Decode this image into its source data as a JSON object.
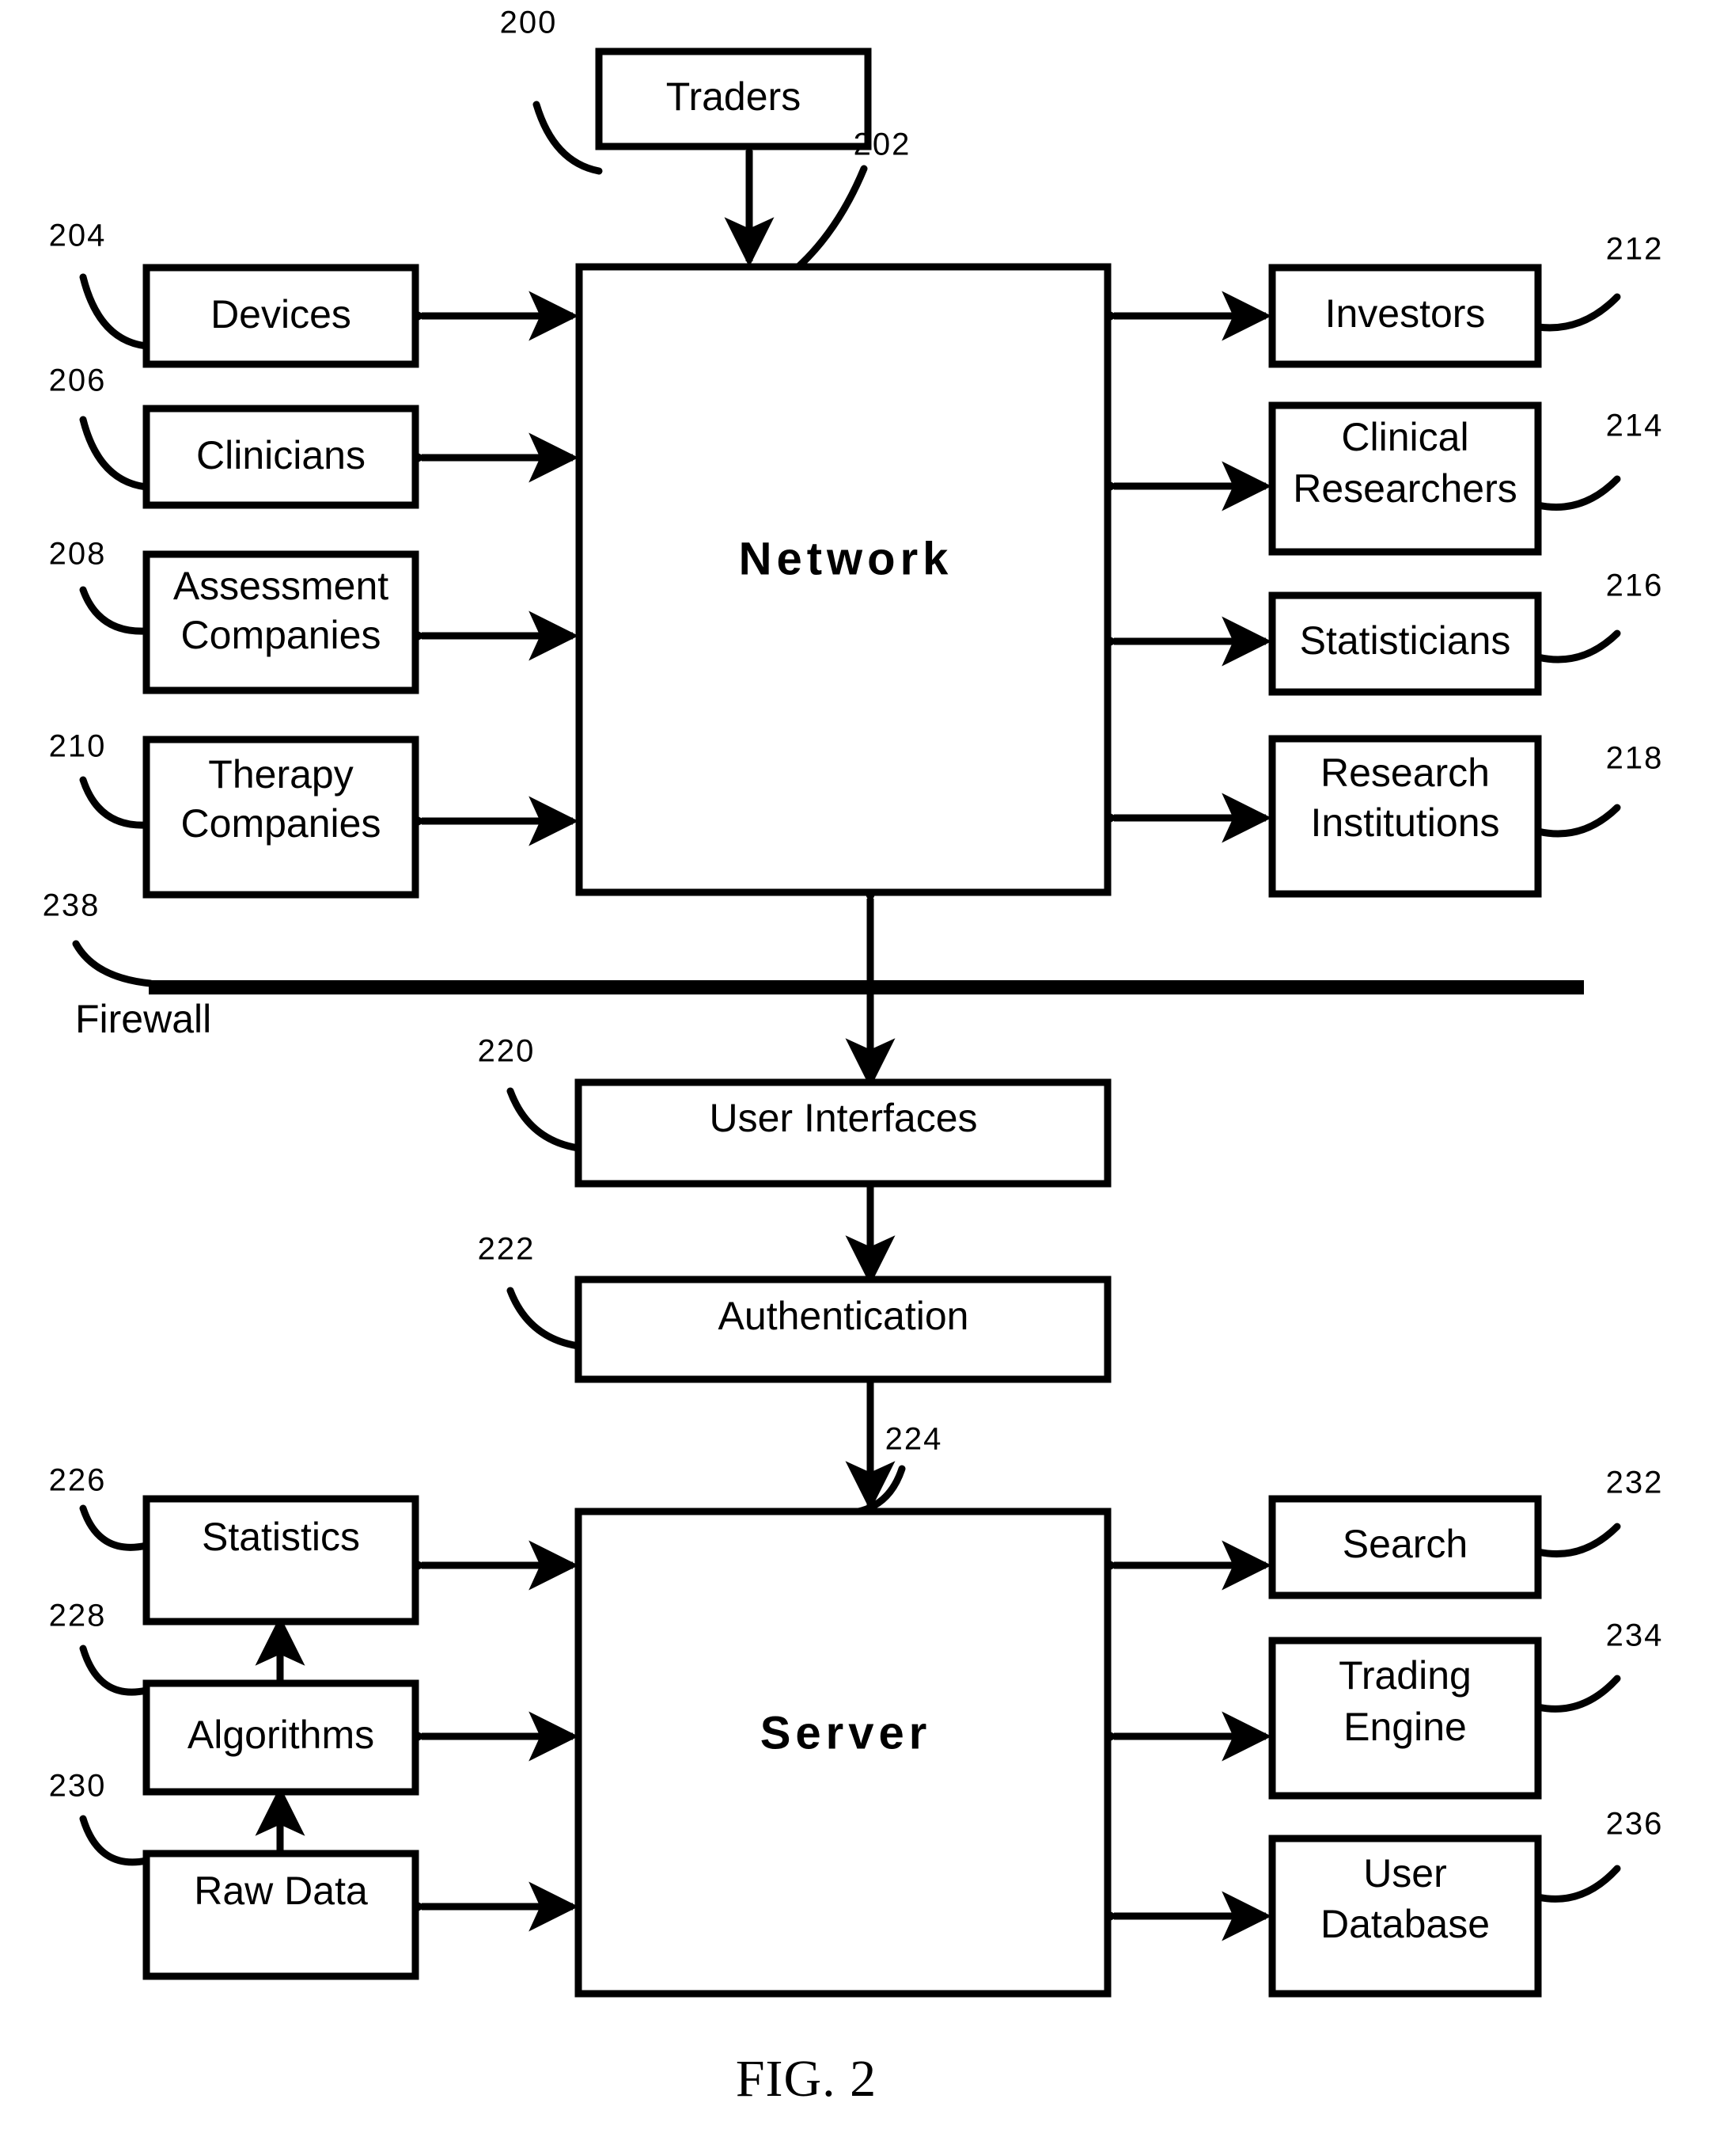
{
  "figure": {
    "caption": "FIG. 2",
    "firewall_label": "Firewall"
  },
  "nodes": {
    "traders": {
      "label": "Traders",
      "ref": "200"
    },
    "network": {
      "label": "Network",
      "ref": "202"
    },
    "devices": {
      "label": "Devices",
      "ref": "204"
    },
    "clinicians": {
      "label": "Clinicians",
      "ref": "206"
    },
    "assessment_line1": {
      "label": "Assessment",
      "ref": "208"
    },
    "assessment_line2": {
      "label": "Companies"
    },
    "therapy_line1": {
      "label": "Therapy",
      "ref": "210"
    },
    "therapy_line2": {
      "label": "Companies"
    },
    "investors": {
      "label": "Investors",
      "ref": "212"
    },
    "clinical_line1": {
      "label": "Clinical",
      "ref": "214"
    },
    "clinical_line2": {
      "label": "Researchers"
    },
    "statisticians": {
      "label": "Statisticians",
      "ref": "216"
    },
    "research_line1": {
      "label": "Research",
      "ref": "218"
    },
    "research_line2": {
      "label": "Institutions"
    },
    "user_interfaces": {
      "label": "User Interfaces",
      "ref": "220"
    },
    "authentication": {
      "label": "Authentication",
      "ref": "222"
    },
    "server": {
      "label": "Server",
      "ref": "224"
    },
    "statistics": {
      "label": "Statistics",
      "ref": "226"
    },
    "algorithms": {
      "label": "Algorithms",
      "ref": "228"
    },
    "raw_data": {
      "label": "Raw Data",
      "ref": "230"
    },
    "search": {
      "label": "Search",
      "ref": "232"
    },
    "trading_line1": {
      "label": "Trading",
      "ref": "234"
    },
    "trading_line2": {
      "label": "Engine"
    },
    "user_db_line1": {
      "label": "User",
      "ref": "236"
    },
    "user_db_line2": {
      "label": "Database"
    },
    "firewall": {
      "label": "Firewall",
      "ref": "238"
    }
  },
  "colors": {
    "stroke": "#000000",
    "fill": "#ffffff"
  }
}
